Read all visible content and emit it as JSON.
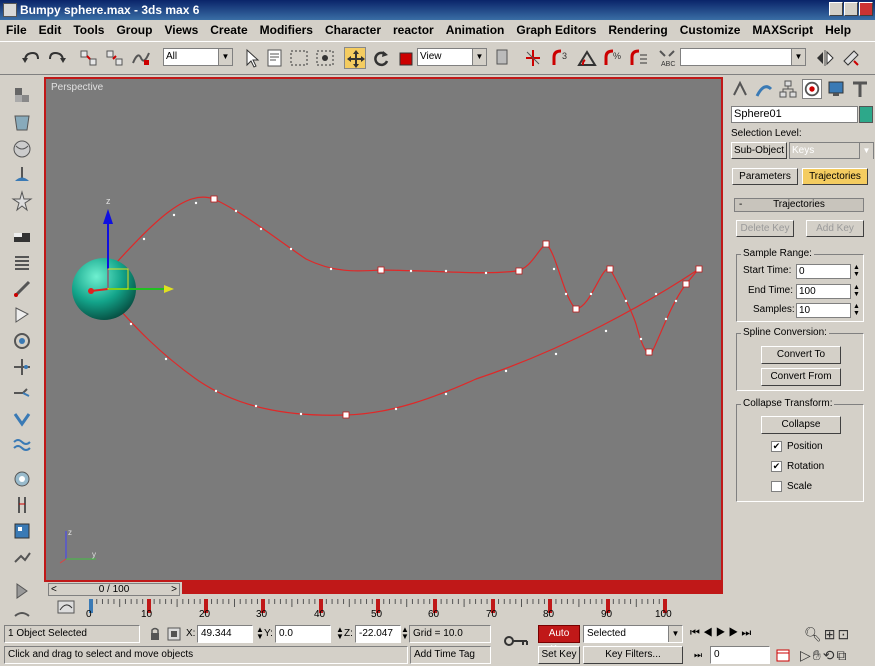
{
  "window": {
    "title": "Bumpy sphere.max - 3ds max 6"
  },
  "menu": [
    "File",
    "Edit",
    "Tools",
    "Group",
    "Views",
    "Create",
    "Modifiers",
    "Character",
    "reactor",
    "Animation",
    "Graph Editors",
    "Rendering",
    "Customize",
    "MAXScript",
    "Help"
  ],
  "toolbar": {
    "selection_filter": "All",
    "ref_coord": "View",
    "named_selection": ""
  },
  "viewport": {
    "label": "Perspective"
  },
  "command_panel": {
    "object_name": "Sphere01",
    "object_color": "#2da88a",
    "selection_level_label": "Selection Level:",
    "sub_object_label": "Sub-Object",
    "sub_object_value": "Keys",
    "tab_parameters": "Parameters",
    "tab_trajectories": "Trajectories",
    "rollout_title": "Trajectories",
    "rollout_toggle": "-",
    "delete_key": "Delete Key",
    "add_key": "Add Key",
    "sample_range_title": "Sample Range:",
    "start_time_label": "Start Time:",
    "start_time_value": "0",
    "end_time_label": "End Time:",
    "end_time_value": "100",
    "samples_label": "Samples:",
    "samples_value": "10",
    "spline_conversion_title": "Spline Conversion:",
    "convert_to": "Convert To",
    "convert_from": "Convert From",
    "collapse_transform_title": "Collapse Transform:",
    "collapse": "Collapse",
    "position_label": "Position",
    "rotation_label": "Rotation",
    "scale_label": "Scale",
    "position_checked": true,
    "rotation_checked": true,
    "scale_checked": false
  },
  "timeslider": {
    "label": "0 / 100"
  },
  "trackbar": {
    "ticks": [
      "0",
      "10",
      "20",
      "30",
      "40",
      "50",
      "60",
      "70",
      "80",
      "90",
      "100"
    ]
  },
  "status": {
    "selected": "1 Object Selected",
    "prompt": "Click and drag to select and move objects",
    "x_label": "X:",
    "x_value": "49.344",
    "y_label": "Y:",
    "y_value": "0.0",
    "z_label": "Z:",
    "z_value": "-22.047",
    "grid": "Grid = 10.0",
    "add_time_tag": "Add Time Tag",
    "auto_key": "Auto Key",
    "selected_filter": "Selected",
    "set_key": "Set Key",
    "key_filters": "Key Filters...",
    "frame_value": "0"
  }
}
